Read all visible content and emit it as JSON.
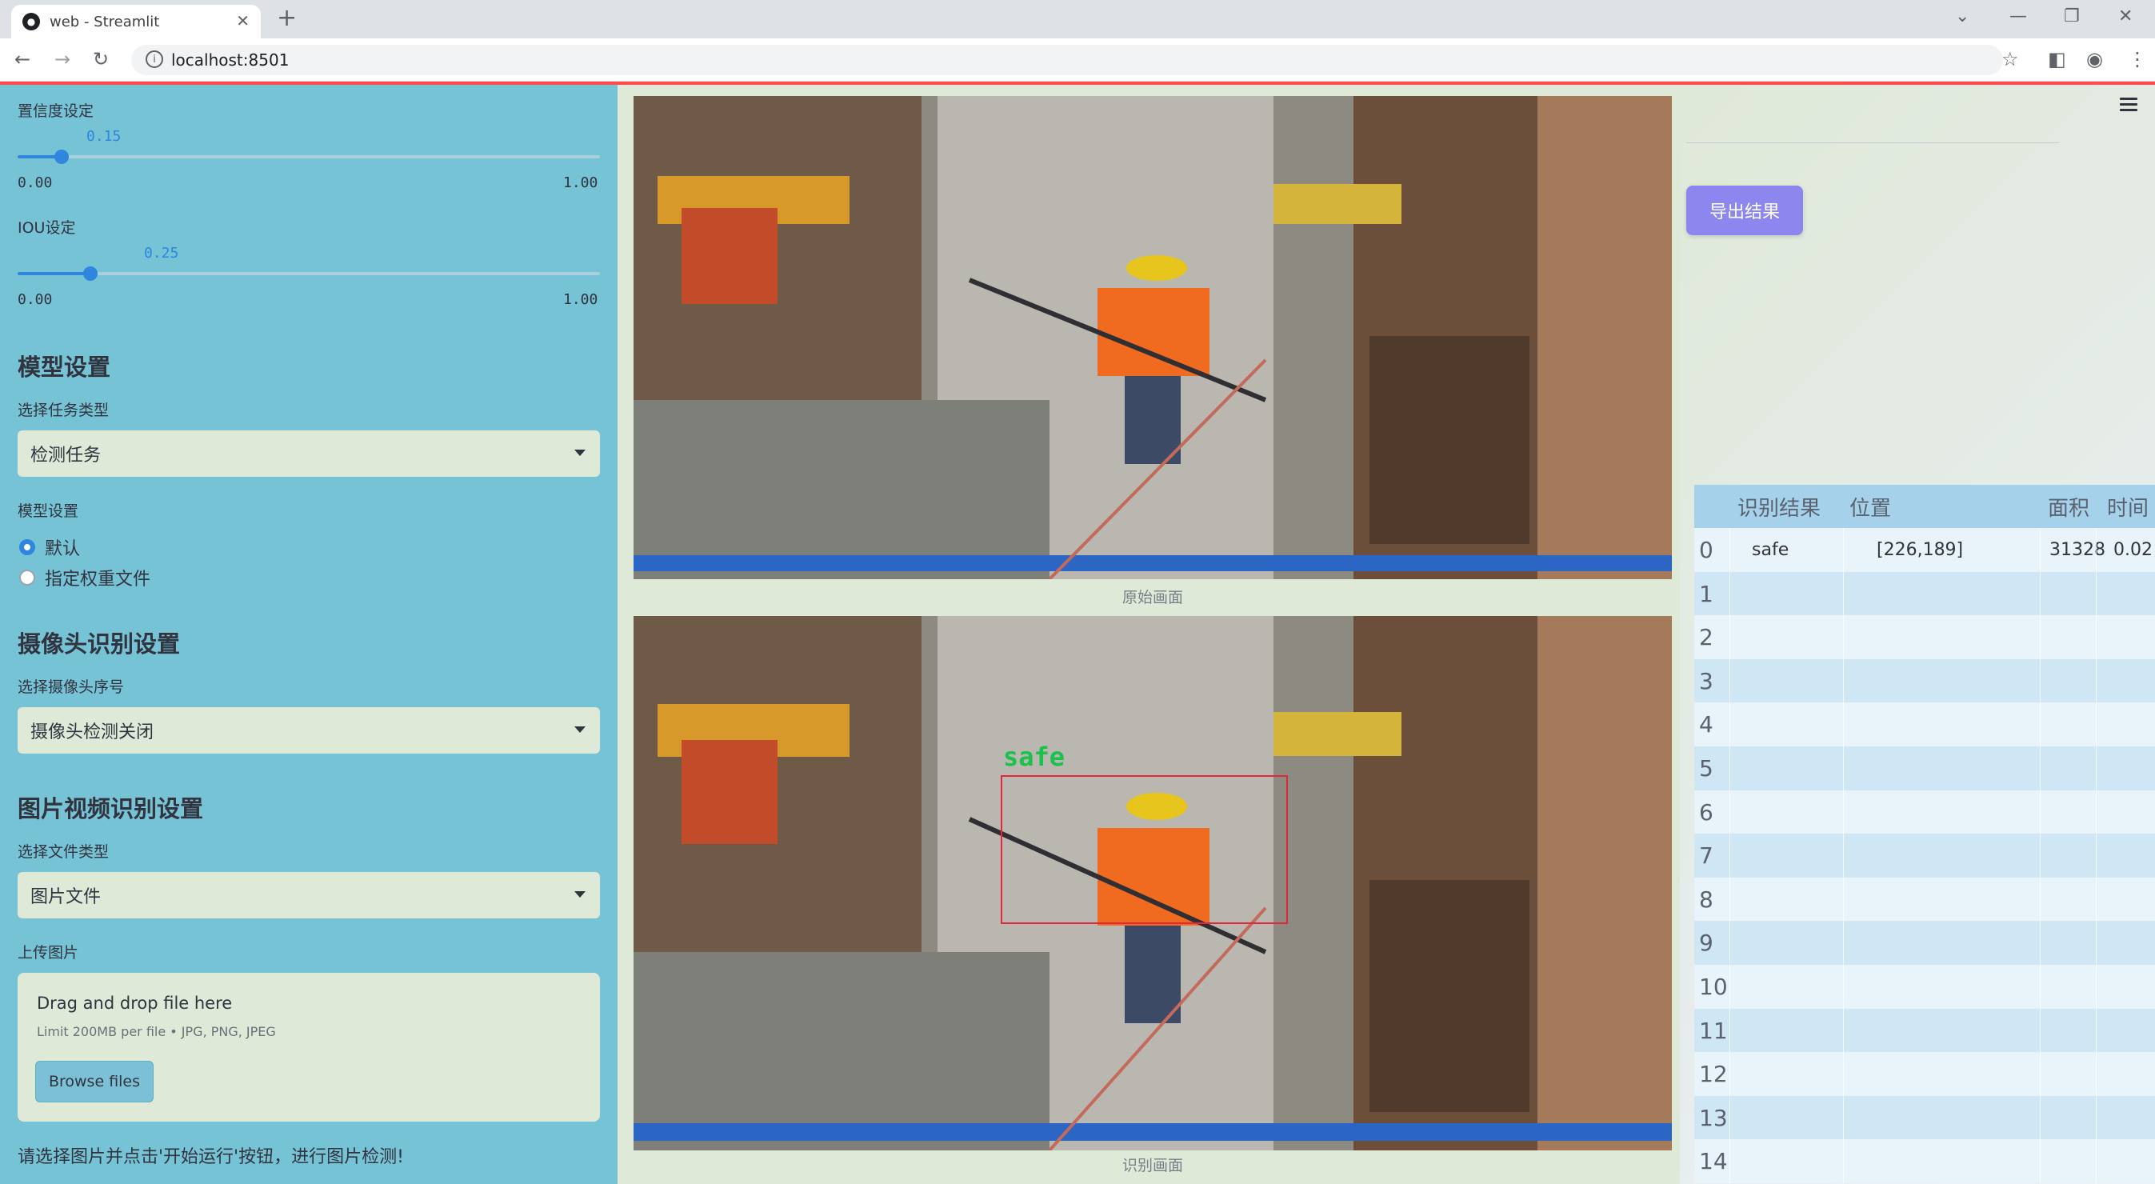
{
  "browser": {
    "tab_title": "web - Streamlit",
    "url": "localhost:8501"
  },
  "sidebar": {
    "confidence": {
      "label": "置信度设定",
      "value": "0.15",
      "min": "0.00",
      "max": "1.00",
      "fraction": 0.15
    },
    "iou": {
      "label": "IOU设定",
      "value": "0.25",
      "min": "0.00",
      "max": "1.00",
      "fraction": 0.25
    },
    "model_section": {
      "title": "模型设置",
      "task_label": "选择任务类型",
      "task_value": "检测任务",
      "model_label": "模型设置",
      "options": [
        "默认",
        "指定权重文件"
      ],
      "selected_index": 0
    },
    "camera_section": {
      "title": "摄像头识别设置",
      "label": "选择摄像头序号",
      "value": "摄像头检测关闭"
    },
    "media_section": {
      "title": "图片视频识别设置",
      "file_type_label": "选择文件类型",
      "file_type_value": "图片文件",
      "upload_label": "上传图片",
      "drop_title": "Drag and drop file here",
      "drop_sub": "Limit 200MB per file • JPG, PNG, JPEG",
      "browse_label": "Browse files"
    },
    "hint": "请选择图片并点击'开始运行'按钮，进行图片检测!"
  },
  "main": {
    "original_caption": "原始画面",
    "result_caption": "识别画面",
    "detection_label": "safe"
  },
  "right": {
    "export_label": "导出结果",
    "table": {
      "headers": [
        "",
        "识别结果",
        "位置",
        "面积",
        "时间"
      ],
      "rows": [
        {
          "idx": "0",
          "result": "safe",
          "pos": "[226,189]",
          "area": "31328",
          "time": "0.02"
        },
        {
          "idx": "1",
          "result": "",
          "pos": "",
          "area": "",
          "time": ""
        },
        {
          "idx": "2",
          "result": "",
          "pos": "",
          "area": "",
          "time": ""
        },
        {
          "idx": "3",
          "result": "",
          "pos": "",
          "area": "",
          "time": ""
        },
        {
          "idx": "4",
          "result": "",
          "pos": "",
          "area": "",
          "time": ""
        },
        {
          "idx": "5",
          "result": "",
          "pos": "",
          "area": "",
          "time": ""
        },
        {
          "idx": "6",
          "result": "",
          "pos": "",
          "area": "",
          "time": ""
        },
        {
          "idx": "7",
          "result": "",
          "pos": "",
          "area": "",
          "time": ""
        },
        {
          "idx": "8",
          "result": "",
          "pos": "",
          "area": "",
          "time": ""
        },
        {
          "idx": "9",
          "result": "",
          "pos": "",
          "area": "",
          "time": ""
        },
        {
          "idx": "10",
          "result": "",
          "pos": "",
          "area": "",
          "time": ""
        },
        {
          "idx": "11",
          "result": "",
          "pos": "",
          "area": "",
          "time": ""
        },
        {
          "idx": "12",
          "result": "",
          "pos": "",
          "area": "",
          "time": ""
        },
        {
          "idx": "13",
          "result": "",
          "pos": "",
          "area": "",
          "time": ""
        },
        {
          "idx": "14",
          "result": "",
          "pos": "",
          "area": "",
          "time": ""
        }
      ]
    }
  },
  "colors": {
    "sidebar_bg": "#76c3d6",
    "main_bg": "#dfe9d8",
    "accent": "#2e86de",
    "export_button": "#8c86ee",
    "detection_box": "#e0283a",
    "detection_text": "#19c24a"
  }
}
